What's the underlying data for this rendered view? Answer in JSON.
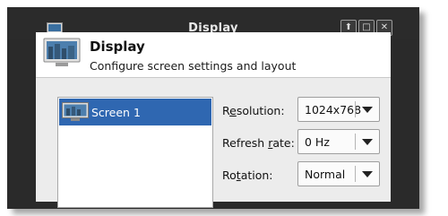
{
  "window": {
    "title": "Display",
    "controls": {
      "up": "⬆",
      "maximize": "□",
      "close": "✕"
    }
  },
  "header": {
    "title": "Display",
    "subtitle": "Configure screen settings and layout"
  },
  "screens": [
    {
      "label": "Screen 1",
      "selected": true
    }
  ],
  "settings": {
    "resolution": {
      "label_pre": "R",
      "label_mn": "e",
      "label_post": "solution:",
      "value": "1024x768"
    },
    "refresh": {
      "label_pre": "Refresh ",
      "label_mn": "r",
      "label_post": "ate:",
      "value": "0 Hz"
    },
    "rotation": {
      "label_pre": "Ro",
      "label_mn": "t",
      "label_post": "ation:",
      "value": "Normal"
    }
  },
  "colors": {
    "selection": "#2f67b1",
    "titlebar": "#2b2b2b",
    "window_bg": "#ececec"
  },
  "icons": {
    "app": "monitor-icon",
    "header": "monitor-icon",
    "list": "monitor-icon",
    "dropdown": "chevron-down-icon"
  }
}
